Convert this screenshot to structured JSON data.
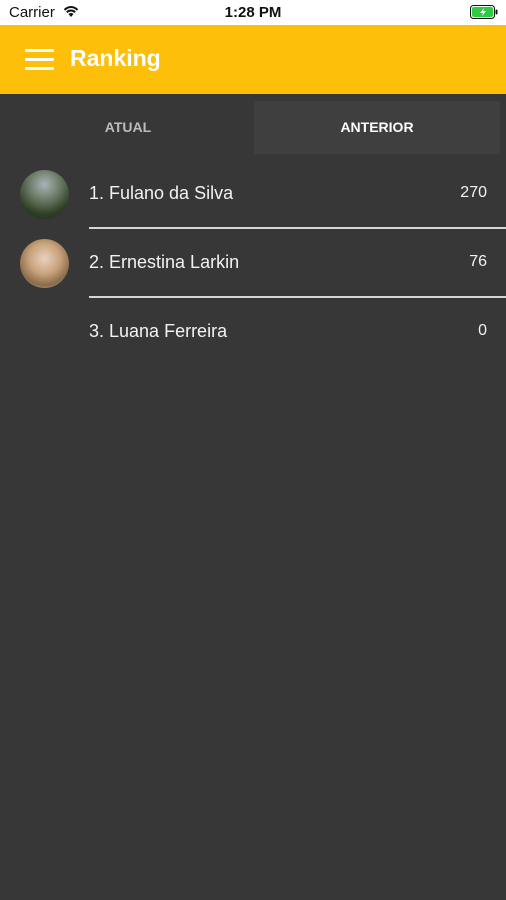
{
  "status_bar": {
    "carrier": "Carrier",
    "time": "1:28 PM"
  },
  "app_bar": {
    "title": "Ranking",
    "menu_icon": "hamburger-icon",
    "color": "#fdbf0a"
  },
  "tabs": [
    {
      "label": "ATUAL",
      "selected": false
    },
    {
      "label": "ANTERIOR",
      "selected": true
    }
  ],
  "ranking": [
    {
      "label": "1. Fulano da Silva",
      "score": "270",
      "avatar": true
    },
    {
      "label": "2. Ernestina Larkin",
      "score": "76",
      "avatar": true
    },
    {
      "label": "3. Luana Ferreira",
      "score": "0",
      "avatar": false
    }
  ]
}
